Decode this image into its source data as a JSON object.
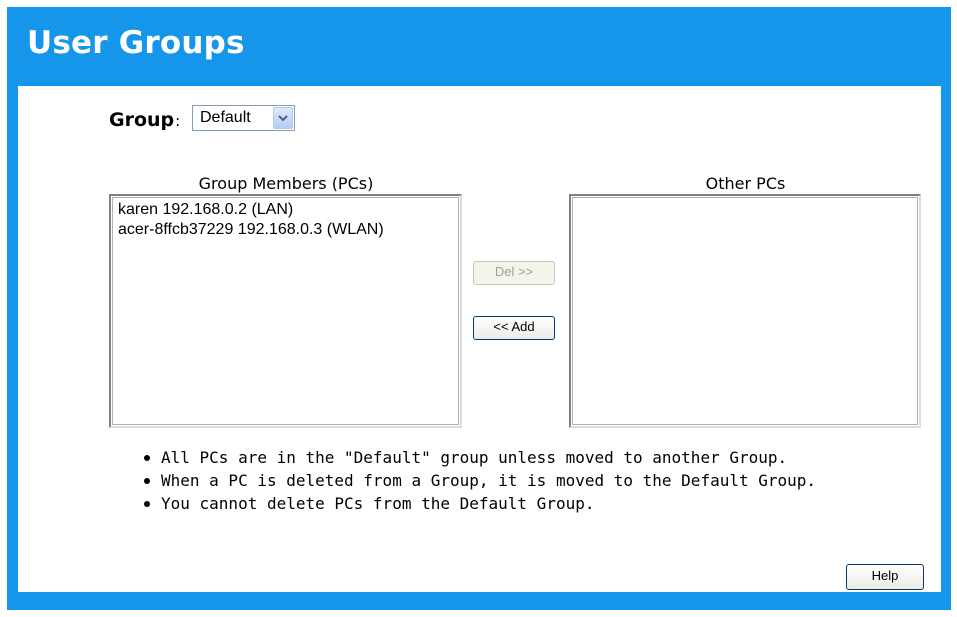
{
  "page": {
    "title": "User Groups"
  },
  "group": {
    "label": "Group",
    "colon": ":",
    "selected": "Default"
  },
  "members": {
    "title": "Group Members (PCs)",
    "items": [
      "karen 192.168.0.2 (LAN)",
      "acer-8ffcb37229 192.168.0.3 (WLAN)"
    ]
  },
  "others": {
    "title": "Other PCs",
    "items": []
  },
  "buttons": {
    "del": "Del >>",
    "add": "<< Add",
    "help": "Help"
  },
  "notes": [
    "All PCs are in the \"Default\" group unless moved to another Group.",
    "When a PC is deleted from a Group, it is moved to the Default Group.",
    "You cannot delete PCs from the Default Group."
  ],
  "colors": {
    "frame": "#1596ea",
    "content_background": "#ffffff"
  },
  "icons": {
    "dropdown": "chevron-down-icon",
    "bullet": "bullet-icon"
  }
}
